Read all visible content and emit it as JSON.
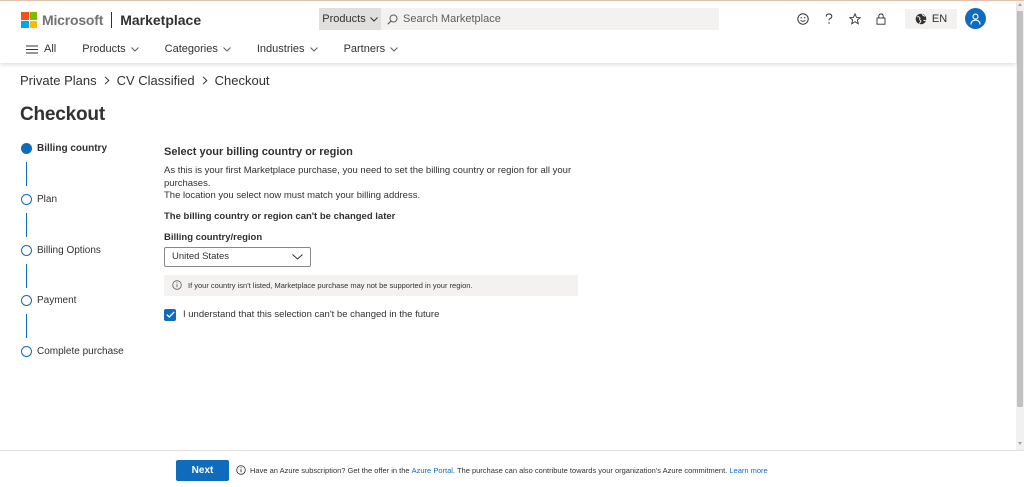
{
  "header": {
    "brand_name": "Microsoft",
    "product_name": "Marketplace",
    "search_scope": "Products",
    "search_placeholder": "Search Marketplace",
    "language": "EN"
  },
  "nav": {
    "all_label": "All",
    "items": [
      {
        "label": "Products"
      },
      {
        "label": "Categories"
      },
      {
        "label": "Industries"
      },
      {
        "label": "Partners"
      }
    ]
  },
  "breadcrumb": [
    "Private Plans",
    "CV Classified",
    "Checkout"
  ],
  "page_title": "Checkout",
  "steps": [
    {
      "label": "Billing country",
      "active": true
    },
    {
      "label": "Plan",
      "active": false
    },
    {
      "label": "Billing Options",
      "active": false
    },
    {
      "label": "Payment",
      "active": false
    },
    {
      "label": "Complete purchase",
      "active": false
    }
  ],
  "main": {
    "section_title": "Select your billing country or region",
    "description_line1": "As this is your first Marketplace purchase, you need to set the billing country or region for all your purchases.",
    "description_line2": "The location you select now must match your billing address.",
    "bold_note": "The billing country or region can't be changed later",
    "field_label": "Billing country/region",
    "selected_country": "United States",
    "info_message": "If your country isn't listed, Marketplace purchase may not be supported in your region.",
    "checkbox_label": "I understand that this selection can't be changed in the future",
    "checkbox_checked": true
  },
  "footer": {
    "next_label": "Next",
    "text_before_link": "Have an Azure subscription? Get the offer in the",
    "portal_link": "Azure Portal",
    "text_after_link": ". The purchase can also contribute towards your organization's Azure commitment.",
    "learn_more": "Learn more"
  },
  "colors": {
    "accent": "#0f6cbd",
    "text": "#323130",
    "info_bg": "#f3f2f1"
  }
}
